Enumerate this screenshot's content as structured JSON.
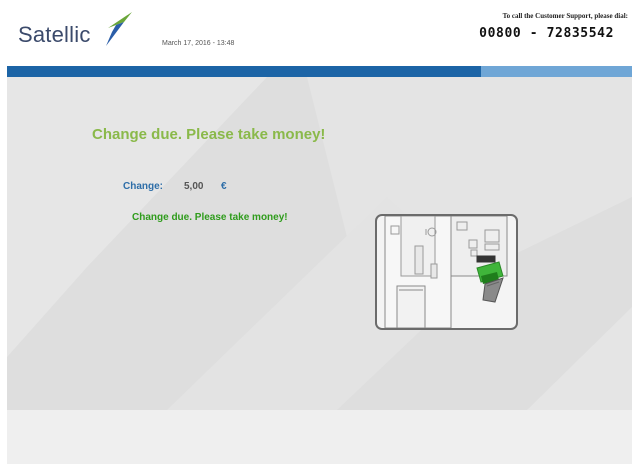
{
  "header": {
    "logo_text": "Satellic",
    "datetime": "March 17, 2016 - 13:48",
    "support_label": "To call the Customer Support, please dial:",
    "support_phone": "00800 - 72835542"
  },
  "main": {
    "headline": "Change due. Please take money!",
    "change_label": "Change:",
    "change_amount": "5,00",
    "change_currency": "€",
    "sub_message": "Change due. Please take money!"
  },
  "colors": {
    "brand_blue": "#1c64a6",
    "brand_light_blue": "#6fa6d6",
    "headline_green": "#8ab94a",
    "message_green": "#2f9c1c"
  },
  "icons": {
    "logo": "satellic-logo-mark",
    "illustration": "kiosk-money-dispenser-illustration"
  }
}
